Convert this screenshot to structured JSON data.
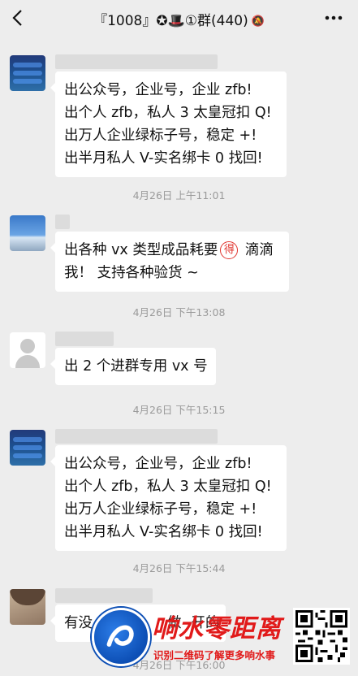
{
  "header": {
    "back_icon": "chevron-left-icon",
    "title": "『1008』✪🎩①群(440)",
    "mute_icon": "bell-off-icon",
    "more_icon": "more-dots-icon"
  },
  "messages": [
    {
      "avatar": "blue-banner-avatar",
      "lines": [
        "出公众号，企业号，企业 zfb!",
        "出个人 zfb，私人 3 太皇冠扣 Q!",
        "出万人企业绿标子号，稳定 +!",
        "出半月私人 V-实名绑卡 0 找回!"
      ],
      "time": "4月26日 上午11:01"
    },
    {
      "avatar": "sky-avatar",
      "lines_before": "出各种 vx 类型成品耗要",
      "emoji_char": "得",
      "lines_after": " 滴滴",
      "line2": "我！ 支持各种验货 ~",
      "time": "4月26日 下午13:08"
    },
    {
      "avatar": "default-avatar",
      "lines": [
        "出 2 个进群专用 vx 号"
      ],
      "time": "4月26日 下午15:15"
    },
    {
      "avatar": "blue-banner-avatar",
      "lines": [
        "出公众号，企业号，企业 zfb!",
        "出个人 zfb，私人 3 太皇冠扣 Q!",
        "出万人企业绿标子号，稳定 +!",
        "出半月私人 V-实名绑卡 0 找回!"
      ],
      "time": "4月26日 下午15:44"
    },
    {
      "avatar": "person-avatar",
      "lines": [
        "有没",
        "做",
        "开的"
      ],
      "time": "4月26日 下午16:00"
    }
  ],
  "watermark": {
    "title": "响水零距离",
    "subtitle": "识别二维码了解更多响水事",
    "logo_icon": "swirl-logo-icon",
    "qr_icon": "qr-code-icon"
  }
}
